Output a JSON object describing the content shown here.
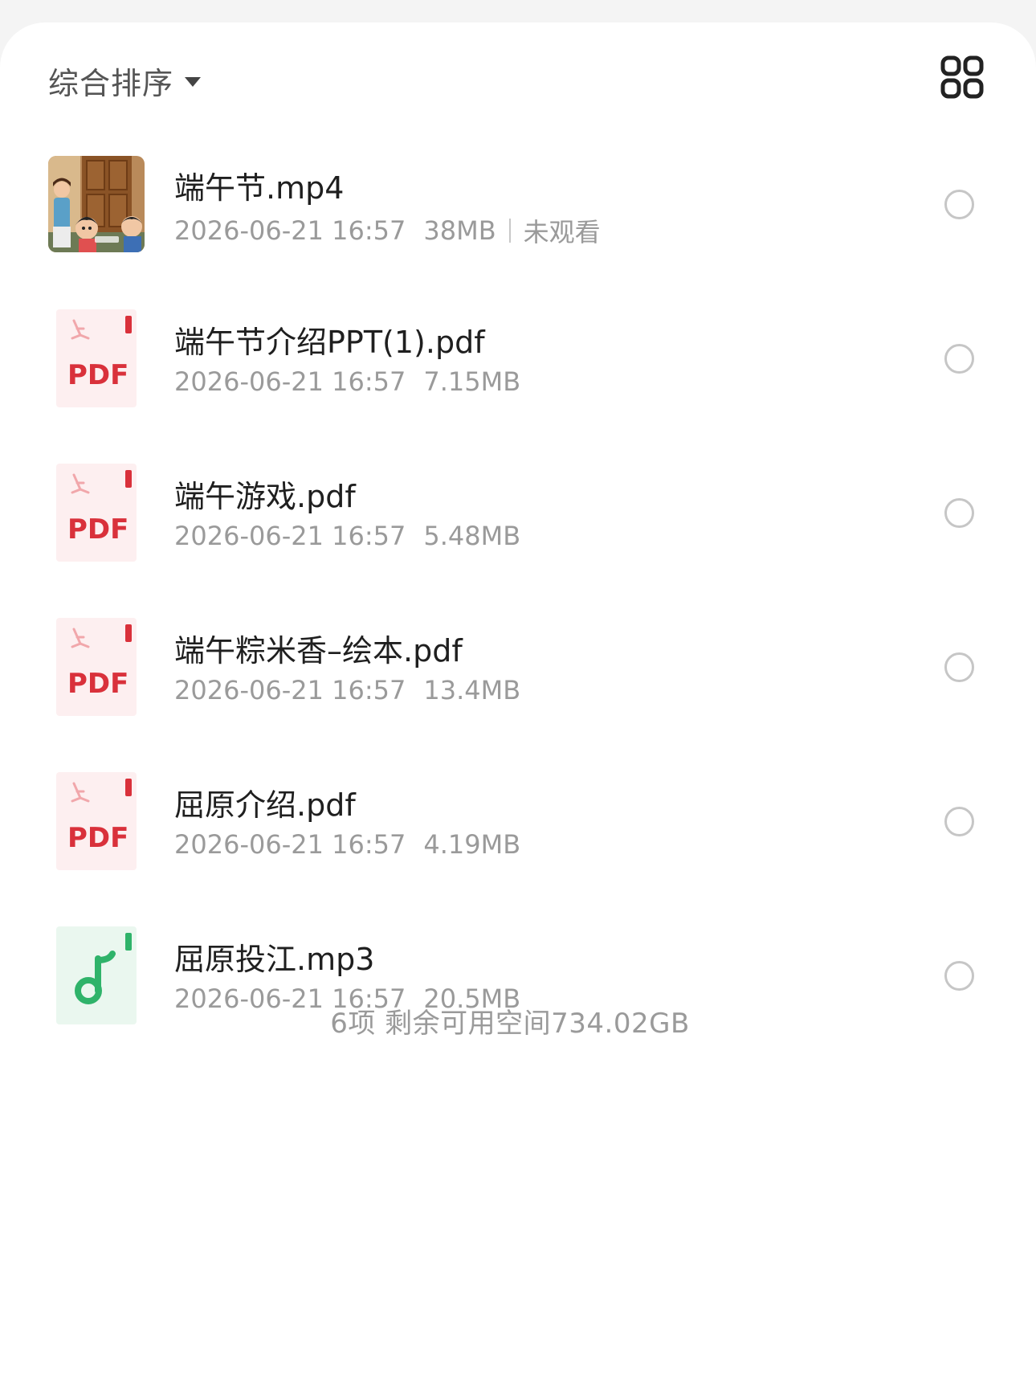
{
  "toolbar": {
    "sort_label": "综合排序",
    "sort_icon": "caret-down-icon",
    "view_toggle_icon": "grid-view-icon"
  },
  "files": [
    {
      "name": "端午节.mp4",
      "date": "2026-06-21 16:57",
      "size": "38MB",
      "status": "未观看",
      "type": "video",
      "icon": "video-thumbnail"
    },
    {
      "name": "端午节介绍PPT(1).pdf",
      "date": "2026-06-21 16:57",
      "size": "7.15MB",
      "type": "pdf",
      "icon_label": "PDF"
    },
    {
      "name": "端午游戏.pdf",
      "date": "2026-06-21 16:57",
      "size": "5.48MB",
      "type": "pdf",
      "icon_label": "PDF"
    },
    {
      "name": "端午粽米香–绘本.pdf",
      "date": "2026-06-21 16:57",
      "size": "13.4MB",
      "type": "pdf",
      "icon_label": "PDF"
    },
    {
      "name": "屈原介绍.pdf",
      "date": "2026-06-21 16:57",
      "size": "4.19MB",
      "type": "pdf",
      "icon_label": "PDF"
    },
    {
      "name": "屈原投江.mp3",
      "date": "2026-06-21 16:57",
      "size": "20.5MB",
      "type": "audio",
      "icon": "music-note-icon"
    }
  ],
  "summary": "6项 剩余可用空间734.02GB",
  "colors": {
    "pdf_red": "#d9313b",
    "pdf_bg": "#fdeff0",
    "audio_green": "#2fb36a",
    "audio_bg": "#eaf7ef",
    "radio_border": "#c6c6c6"
  }
}
